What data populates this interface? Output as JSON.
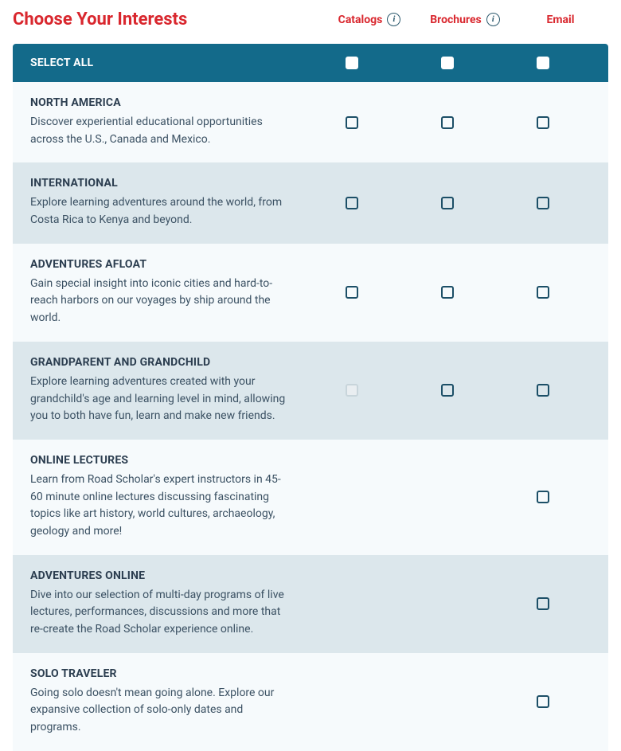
{
  "title": "Choose Your Interests",
  "columns": {
    "catalogs": "Catalogs",
    "brochures": "Brochures",
    "email": "Email"
  },
  "select_all": {
    "label": "SELECT ALL"
  },
  "rows": [
    {
      "key": "north-america",
      "title": "NORTH AMERICA",
      "desc": "Discover experiential educational opportunities across the U.S., Canada and Mexico.",
      "catalogs": "enabled",
      "brochures": "enabled",
      "email": "enabled",
      "alt": "light"
    },
    {
      "key": "international",
      "title": "INTERNATIONAL",
      "desc": "Explore learning adventures around the world, from Costa Rica to Kenya and beyond.",
      "catalogs": "enabled",
      "brochures": "enabled",
      "email": "enabled",
      "alt": "dark"
    },
    {
      "key": "adventures-afloat",
      "title": "ADVENTURES AFLOAT",
      "desc": "Gain special insight into iconic cities and hard-to-reach harbors on our voyages by ship around the world.",
      "catalogs": "enabled",
      "brochures": "enabled",
      "email": "enabled",
      "alt": "light"
    },
    {
      "key": "grandparent-grandchild",
      "title": "GRANDPARENT AND GRANDCHILD",
      "desc": "Explore learning adventures created with your grandchild's age and learning level in mind, allowing you to both have fun, learn and make new friends.",
      "catalogs": "disabled",
      "brochures": "enabled",
      "email": "enabled",
      "alt": "dark"
    },
    {
      "key": "online-lectures",
      "title": "ONLINE LECTURES",
      "desc": "Learn from Road Scholar's expert instructors in 45-60 minute online lectures discussing fascinating topics like art history, world cultures, archaeology, geology and more!",
      "catalogs": "none",
      "brochures": "none",
      "email": "enabled",
      "alt": "light"
    },
    {
      "key": "adventures-online",
      "title": "ADVENTURES ONLINE",
      "desc": "Dive into our selection of multi-day programs of live lectures, performances, discussions and more that re-create the Road Scholar experience online.",
      "catalogs": "none",
      "brochures": "none",
      "email": "enabled",
      "alt": "dark"
    },
    {
      "key": "solo-traveler",
      "title": "SOLO TRAVELER",
      "desc": "Going solo doesn't mean going alone. Explore our expansive collection of solo-only dates and programs.",
      "catalogs": "none",
      "brochures": "none",
      "email": "enabled",
      "alt": "light"
    }
  ]
}
